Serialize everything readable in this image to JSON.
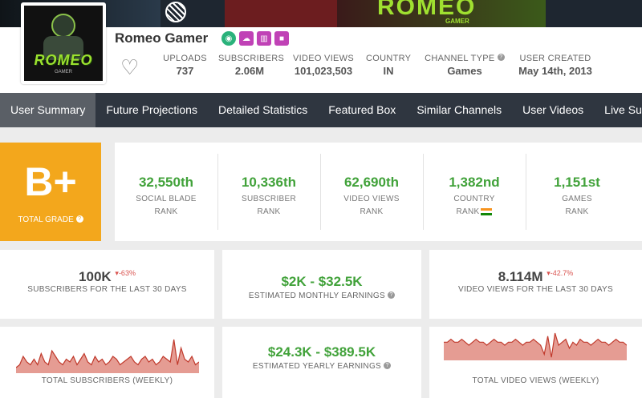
{
  "banner": {
    "word": "ROMEO",
    "sub": "GAMER"
  },
  "channel": {
    "name": "Romeo Gamer",
    "avatar_text": "ROMEO",
    "avatar_sub": "GAMER"
  },
  "badges": [
    {
      "icon": "eye-icon",
      "color": "#2ab27b"
    },
    {
      "icon": "cloud-upload-icon",
      "color": "#c042b6"
    },
    {
      "icon": "bar-chart-icon",
      "color": "#c042b6"
    },
    {
      "icon": "video-camera-icon",
      "color": "#c042b6"
    }
  ],
  "stats": {
    "uploads": {
      "label": "UPLOADS",
      "value": "737"
    },
    "subscribers": {
      "label": "SUBSCRIBERS",
      "value": "2.06M"
    },
    "video_views": {
      "label": "VIDEO VIEWS",
      "value": "101,023,503"
    },
    "country": {
      "label": "COUNTRY",
      "value": "IN"
    },
    "channel_type": {
      "label": "CHANNEL TYPE",
      "value": "Games"
    },
    "user_created": {
      "label": "USER CREATED",
      "value": "May 14th, 2013"
    }
  },
  "nav": [
    {
      "label": "User Summary",
      "active": true
    },
    {
      "label": "Future Projections"
    },
    {
      "label": "Detailed Statistics"
    },
    {
      "label": "Featured Box"
    },
    {
      "label": "Similar Channels"
    },
    {
      "label": "User Videos"
    },
    {
      "label": "Live Subscriber"
    }
  ],
  "grade": {
    "letter": "B+",
    "label": "TOTAL GRADE"
  },
  "ranks": [
    {
      "value": "32,550th",
      "line1": "SOCIAL BLADE",
      "line2": "RANK"
    },
    {
      "value": "10,336th",
      "line1": "SUBSCRIBER",
      "line2": "RANK"
    },
    {
      "value": "62,690th",
      "line1": "VIDEO VIEWS",
      "line2": "RANK"
    },
    {
      "value": "1,382nd",
      "line1": "COUNTRY",
      "line2": "RANK"
    },
    {
      "value": "1,151st",
      "line1": "GAMES",
      "line2": "RANK"
    }
  ],
  "cards": {
    "subs30": {
      "value": "100K",
      "delta": "-63%",
      "label": "SUBSCRIBERS FOR THE LAST 30 DAYS"
    },
    "monthly": {
      "value": "$2K  -  $32.5K",
      "label": "ESTIMATED MONTHLY EARNINGS"
    },
    "views30": {
      "value": "8.114M",
      "delta": "-42.7%",
      "label": "VIDEO VIEWS FOR THE LAST 30 DAYS"
    },
    "total_subs": {
      "label": "TOTAL SUBSCRIBERS (WEEKLY)"
    },
    "yearly": {
      "value": "$24.3K  -  $389.5K",
      "label": "ESTIMATED YEARLY EARNINGS"
    },
    "total_views": {
      "label": "TOTAL VIDEO VIEWS (WEEKLY)"
    }
  },
  "colors": {
    "accent_green": "#41a23a",
    "grade_orange": "#f3a71c",
    "nav_bg": "#2f3640",
    "sparkline": "#c0392b"
  },
  "sparklines": {
    "subs": [
      2,
      3,
      6,
      4,
      3,
      5,
      3,
      7,
      4,
      3,
      8,
      6,
      4,
      3,
      5,
      4,
      6,
      3,
      5,
      7,
      4,
      3,
      6,
      4,
      5,
      3,
      4,
      6,
      5,
      3,
      4,
      5,
      6,
      4,
      3,
      5,
      6,
      4,
      5,
      3,
      4,
      6,
      5,
      4,
      12,
      3,
      9,
      5,
      4,
      6,
      3,
      4
    ],
    "views": [
      6,
      6,
      7,
      6,
      6,
      7,
      6,
      5,
      6,
      7,
      6,
      6,
      5,
      6,
      7,
      6,
      6,
      5,
      6,
      6,
      7,
      6,
      5,
      6,
      6,
      7,
      6,
      5,
      2,
      8,
      1,
      9,
      5,
      6,
      7,
      4,
      6,
      5,
      7,
      6,
      6,
      5,
      6,
      7,
      6,
      6,
      5,
      6,
      7,
      6,
      6,
      5
    ]
  }
}
